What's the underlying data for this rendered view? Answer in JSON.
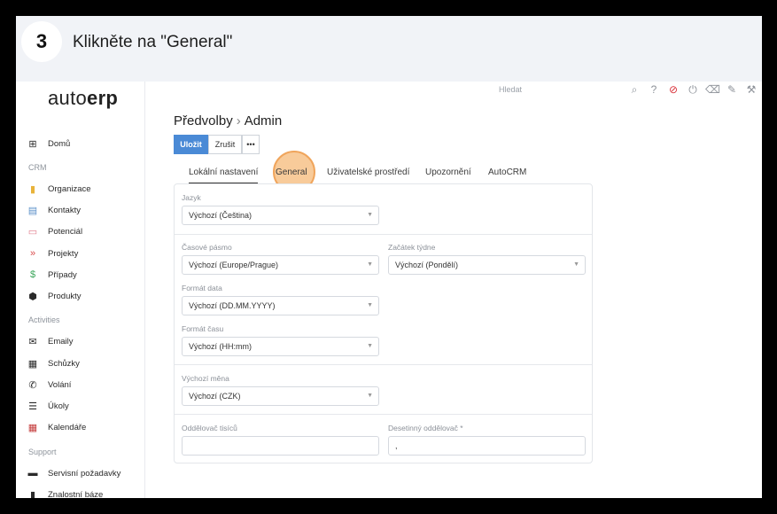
{
  "step": {
    "number": "3",
    "instruction": "Klikněte na \"General\""
  },
  "logo": {
    "light": "auto",
    "bold": "erp"
  },
  "sidebar": {
    "items": [
      {
        "label": "Domů",
        "icon": "⊞"
      },
      {
        "label": "Organizace",
        "icon": "▮"
      },
      {
        "label": "Kontakty",
        "icon": "▤"
      },
      {
        "label": "Potenciál",
        "icon": "▭"
      },
      {
        "label": "Projekty",
        "icon": "»"
      },
      {
        "label": "Případy",
        "icon": "$"
      },
      {
        "label": "Produkty",
        "icon": "⬢"
      },
      {
        "label": "Emaily",
        "icon": "✉"
      },
      {
        "label": "Schůzky",
        "icon": "▦"
      },
      {
        "label": "Volání",
        "icon": "✆"
      },
      {
        "label": "Úkoly",
        "icon": "☰"
      },
      {
        "label": "Kalendáře",
        "icon": "▦"
      },
      {
        "label": "Servisní požadavky",
        "icon": "▬"
      },
      {
        "label": "Znalostní báze",
        "icon": "▮"
      }
    ],
    "sections": [
      "CRM",
      "Activities",
      "Support"
    ]
  },
  "topbar": {
    "search_placeholder": "Hledat"
  },
  "header": {
    "breadcrumb_root": "Předvolby",
    "breadcrumb_separator": "›",
    "breadcrumb_current": "Admin"
  },
  "toolbar": {
    "save_label": "Uložit",
    "cancel_label": "Zrušit",
    "more_label": "•••"
  },
  "tabs": [
    "Lokální nastavení",
    "General",
    "Uživatelské prostředí",
    "Upozornění",
    "AutoCRM"
  ],
  "form": {
    "language": {
      "label": "Jazyk",
      "value": "Výchozí (Čeština)"
    },
    "timezone": {
      "label": "Časové pásmo",
      "value": "Výchozí (Europe/Prague)"
    },
    "week_start": {
      "label": "Začátek týdne",
      "value": "Výchozí (Pondělí)"
    },
    "date_format": {
      "label": "Formát data",
      "value": "Výchozí (DD.MM.YYYY)"
    },
    "time_format": {
      "label": "Formát času",
      "value": "Výchozí (HH:mm)"
    },
    "currency": {
      "label": "Výchozí měna",
      "value": "Výchozí (CZK)"
    },
    "thousand_sep": {
      "label": "Oddělovač tisíců",
      "value": ""
    },
    "decimal_sep": {
      "label": "Desetinný oddělovač *",
      "value": ","
    }
  },
  "colors": {
    "primary": "#4a8ad6",
    "highlight": "#f0a55c",
    "danger": "#d9323b"
  }
}
